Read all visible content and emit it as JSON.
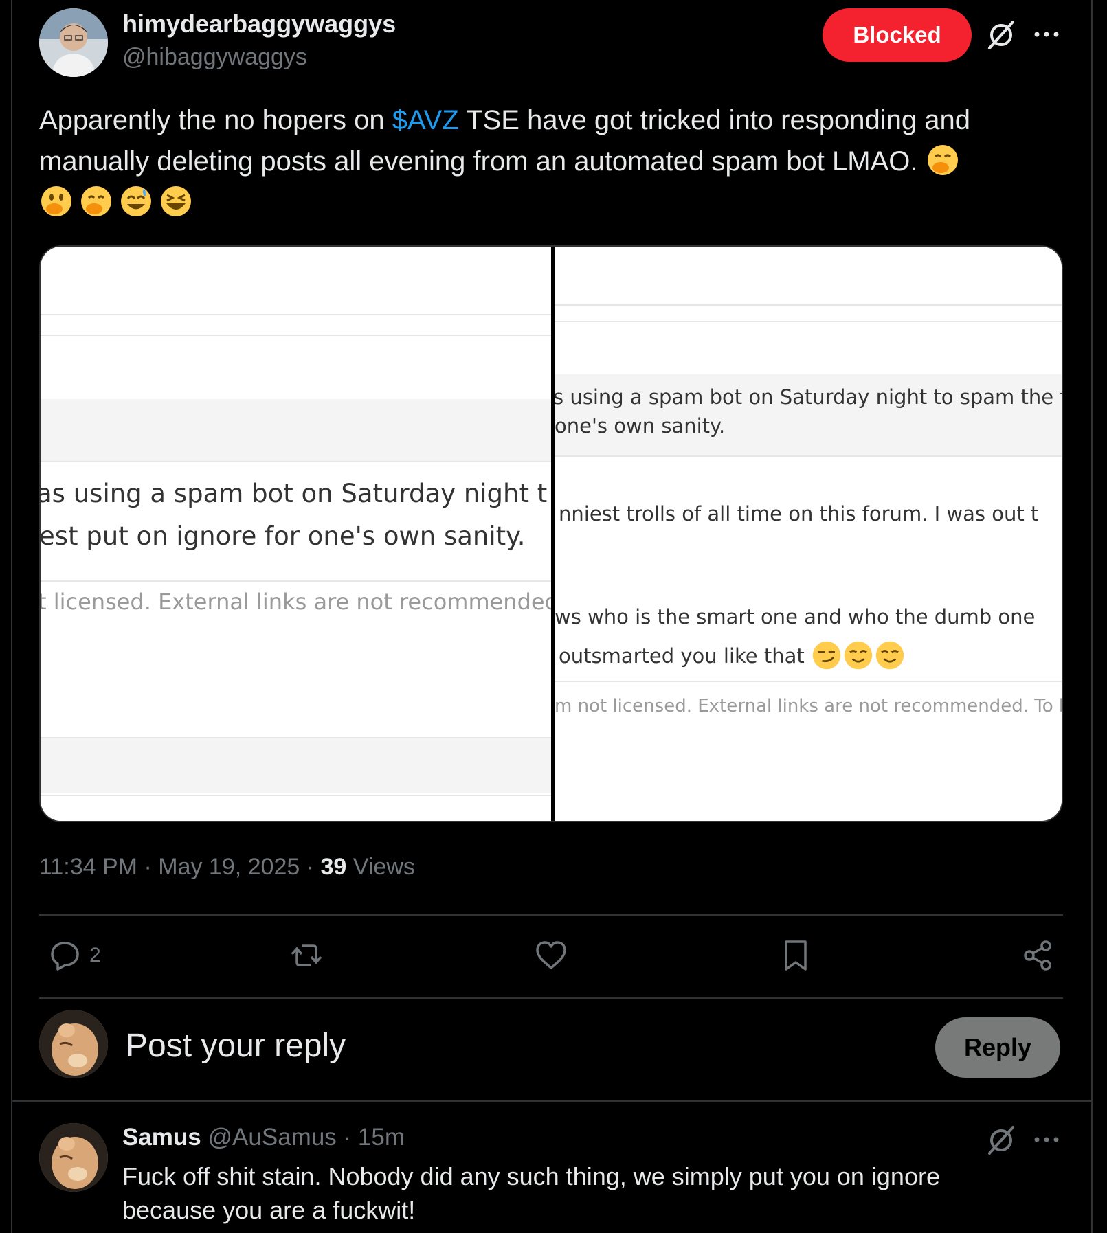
{
  "post": {
    "display_name": "himydearbaggywaggys",
    "handle": "@hibaggywaggys",
    "blocked_label": "Blocked",
    "text_before": "Apparently the no hopers on ",
    "cashtag": "$AVZ",
    "text_after": " TSE have got tricked into responding and manually deleting posts all evening from an automated spam bot LMAO. ",
    "emojis": [
      "face-with-hand-over-mouth",
      "face-with-open-eyes-and-hand-over-mouth",
      "face-with-hand-over-mouth",
      "grinning-face-with-sweat",
      "grinning-squinting-face"
    ],
    "time": "11:34 PM",
    "date": "May 19, 2025",
    "sep": "·",
    "views_count": "39",
    "views_label": "Views"
  },
  "media": {
    "left": {
      "line1": "as using a spam bot on Saturday night t",
      "line2": "est put on ignore for one's own sanity.",
      "footer": "t licensed. External links are not recommended. T"
    },
    "right": {
      "line1": "s using a spam bot on Saturday night to spam the foru",
      "line2": "one's own sanity.",
      "line3": "nniest trolls of all time on this forum. I was out t",
      "line4": "ws who is the smart one and who the dumb one",
      "line5": "outsmarted you like that",
      "footer": "m not licensed. External links are not recommended. To be :"
    }
  },
  "actions": {
    "reply_count": "2",
    "retweet_count": "",
    "like_count": ""
  },
  "composer": {
    "placeholder": "Post your reply",
    "reply_button": "Reply"
  },
  "reply": {
    "name": "Samus",
    "handle": "@AuSamus",
    "sep": "·",
    "time": "15m",
    "text": "Fuck off shit stain. Nobody did any such thing, we simply put you on ignore because you are a fuckwit!"
  },
  "colors": {
    "background": "#000000",
    "accent": "#1d9bf0",
    "blocked": "#f4212e",
    "muted": "#71767b",
    "text": "#e7e9ea"
  }
}
